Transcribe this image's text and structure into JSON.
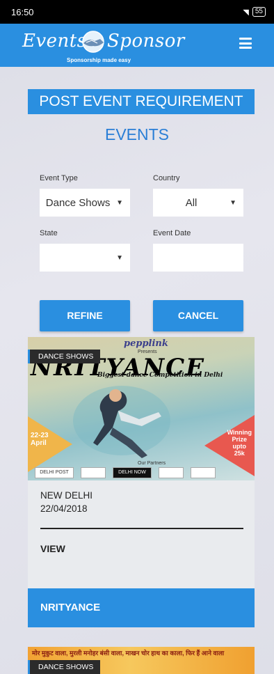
{
  "status": {
    "time": "16:50",
    "battery": "55"
  },
  "header": {
    "logo_word1": "Events",
    "logo_word2": "Sponsor",
    "tagline": "Sponsorship made easy"
  },
  "post_button": "POST EVENT REQUIREMENT",
  "page_title": "EVENTS",
  "filters": {
    "event_type_label": "Event Type",
    "event_type_value": "Dance Shows",
    "country_label": "Country",
    "country_value": "All",
    "state_label": "State",
    "state_value": "",
    "event_date_label": "Event Date",
    "event_date_value": ""
  },
  "buttons": {
    "refine": "REFINE",
    "cancel": "CANCEL"
  },
  "events": [
    {
      "badge": "DANCE SHOWS",
      "poster": {
        "brand": "pepplink",
        "presents": "Presents",
        "title": "NRITYANCE",
        "subtitle": "Biggest dance Competition in Delhi",
        "date_line1": "22-23",
        "date_line2": "April",
        "prize_line1": "Winning",
        "prize_line2": "Prize",
        "prize_line3": "upto",
        "prize_line4": "25k",
        "partners": "Our Partners",
        "logo1": "DELHI POST",
        "logo2": "DELHI NOW"
      },
      "city": "NEW DELHI",
      "date": "22/04/2018",
      "view_label": "VIEW",
      "name": "NRITYANCE"
    },
    {
      "badge": "DANCE SHOWS",
      "banner_text": "मोर मुकुट वाला, मुरली मनोहर बंसी वाला, माखन चोर हाथ का काला, फिर हैं आने वाला"
    }
  ]
}
